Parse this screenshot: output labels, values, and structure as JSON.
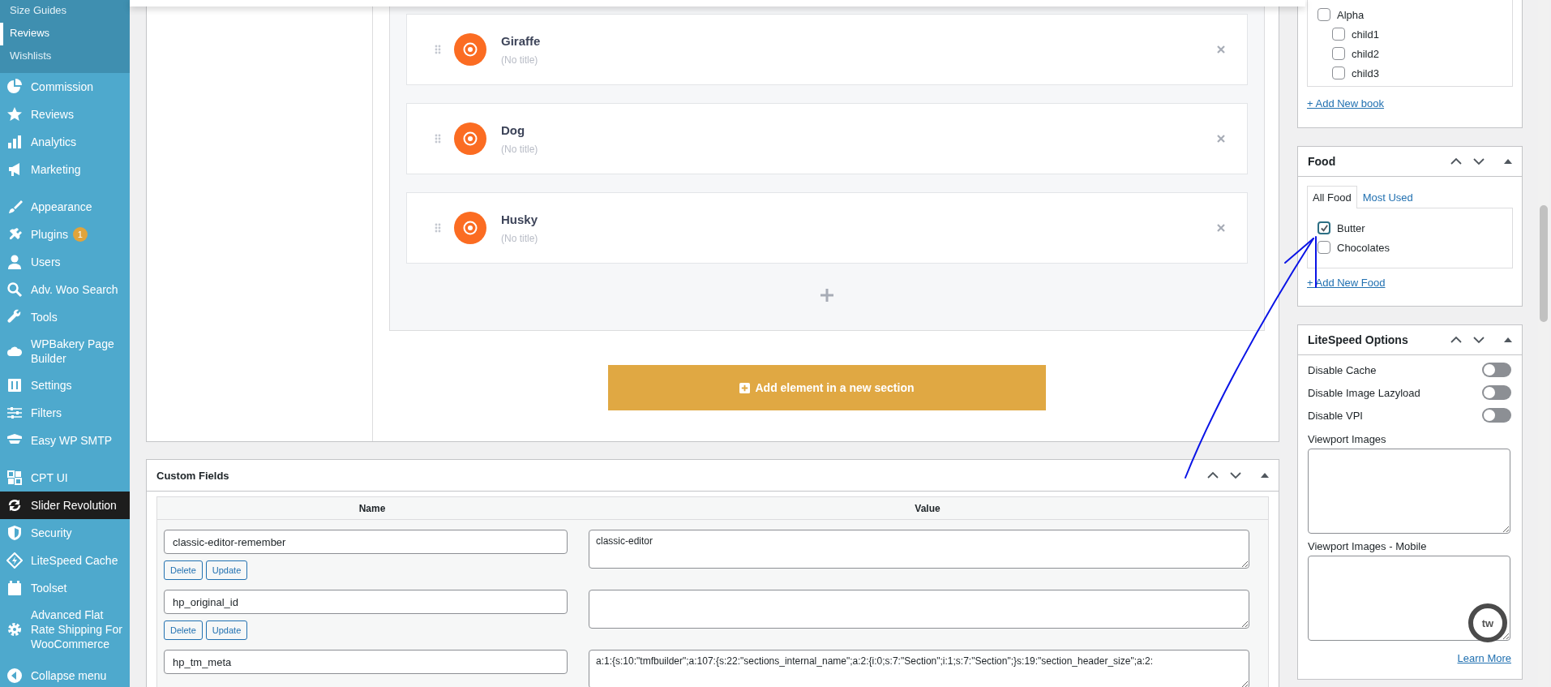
{
  "sidebar": {
    "submenu": [
      {
        "label": "Size Guides",
        "selected": false
      },
      {
        "label": "Reviews",
        "selected": true
      },
      {
        "label": "Wishlists",
        "selected": false
      }
    ],
    "groups": [
      [
        {
          "label": "Commission",
          "selected": false
        },
        {
          "label": "Reviews",
          "selected": false
        },
        {
          "label": "Analytics",
          "selected": false
        },
        {
          "label": "Marketing",
          "selected": false
        }
      ],
      [
        {
          "label": "Appearance",
          "selected": false
        },
        {
          "label": "Plugins",
          "selected": false,
          "badge": "1"
        },
        {
          "label": "Users",
          "selected": false
        },
        {
          "label": "Adv. Woo Search",
          "selected": false
        },
        {
          "label": "Tools",
          "selected": false
        },
        {
          "label": "WPBakery Page Builder",
          "selected": false
        },
        {
          "label": "Settings",
          "selected": false
        },
        {
          "label": "Filters",
          "selected": false
        },
        {
          "label": "Easy WP SMTP",
          "selected": false
        }
      ],
      [
        {
          "label": "CPT UI",
          "selected": false
        },
        {
          "label": "Slider Revolution",
          "selected": true
        },
        {
          "label": "Security",
          "selected": false
        },
        {
          "label": "LiteSpeed Cache",
          "selected": false
        },
        {
          "label": "Toolset",
          "selected": false
        },
        {
          "label": "Advanced Flat Rate Shipping For WooCommerce",
          "selected": false
        }
      ]
    ],
    "collapse": {
      "label": "Collapse menu"
    }
  },
  "builder": {
    "elements": [
      {
        "name": "Giraffe",
        "subtitle": "(No title)"
      },
      {
        "name": "Dog",
        "subtitle": "(No title)"
      },
      {
        "name": "Husky",
        "subtitle": "(No title)"
      }
    ],
    "add_section_button": "Add element in a new section"
  },
  "custom_fields": {
    "title": "Custom Fields",
    "columns": [
      "Name",
      "Value"
    ],
    "rows": [
      {
        "name": "classic-editor-remember",
        "value": "classic-editor",
        "buttons": [
          "Delete",
          "Update"
        ]
      },
      {
        "name": "hp_original_id",
        "value": "",
        "buttons": [
          "Delete",
          "Update"
        ]
      },
      {
        "name": "hp_tm_meta",
        "value": "a:1:{s:10:\"tmfbuilder\";a:107:{s:22:\"sections_internal_name\";a:2:{i:0;s:7:\"Section\";i:1;s:7:\"Section\";}s:19:\"section_header_size\";a:2:"
      }
    ]
  },
  "book_box": {
    "items": [
      {
        "label": "Alpha",
        "checked": false,
        "children": [
          {
            "label": "child1",
            "checked": false
          },
          {
            "label": "child2",
            "checked": false
          },
          {
            "label": "child3",
            "checked": false
          }
        ]
      }
    ],
    "add_link": "+ Add New book"
  },
  "food_box": {
    "title": "Food",
    "tabs": [
      {
        "label": "All Food",
        "selected": true
      },
      {
        "label": "Most Used",
        "selected": false
      }
    ],
    "items": [
      {
        "label": "Butter",
        "checked": true
      },
      {
        "label": "Chocolates",
        "checked": false
      }
    ],
    "add_link": "+ Add New Food"
  },
  "litespeed_box": {
    "title": "LiteSpeed Options",
    "toggles": [
      {
        "label": "Disable Cache",
        "on": false
      },
      {
        "label": "Disable Image Lazyload",
        "on": false
      },
      {
        "label": "Disable VPI",
        "on": false
      }
    ],
    "textareas": [
      {
        "label": "Viewport Images"
      },
      {
        "label": "Viewport Images - Mobile"
      }
    ],
    "learn_more": "Learn More"
  },
  "floating_widget": {
    "label": "tw"
  }
}
